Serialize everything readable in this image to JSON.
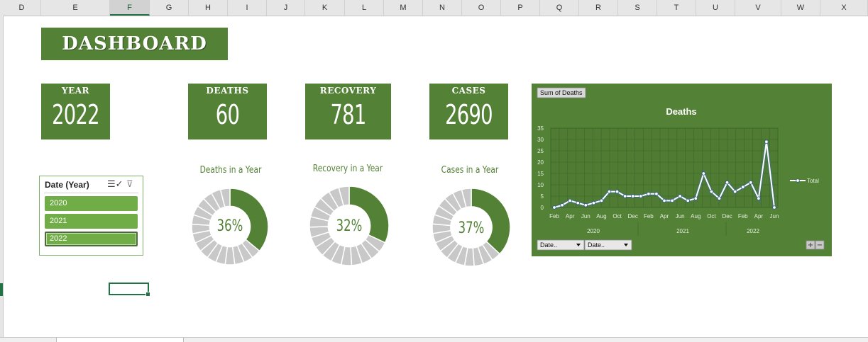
{
  "columns": [
    "D",
    "E",
    "F",
    "G",
    "H",
    "I",
    "J",
    "K",
    "L",
    "M",
    "N",
    "O",
    "P",
    "Q",
    "R",
    "S",
    "T",
    "U",
    "V",
    "W",
    "X"
  ],
  "selected_column": "F",
  "title": "DASHBOARD",
  "kpis": {
    "year": {
      "label": "YEAR",
      "value": "2022"
    },
    "deaths": {
      "label": "DEATHS",
      "value": "60"
    },
    "recovery": {
      "label": "RECOVERY",
      "value": "781"
    },
    "cases": {
      "label": "CASES",
      "value": "2690"
    }
  },
  "slicer": {
    "title": "Date (Year)",
    "items": [
      "2020",
      "2021",
      "2022"
    ],
    "selected": "2022",
    "multiselect_icon": "multi-select-icon",
    "clear_icon": "clear-filter-icon"
  },
  "donuts": [
    {
      "title": "Deaths in a Year",
      "percent_label": "36%",
      "fraction": 0.36
    },
    {
      "title": "Recovery in a Year",
      "percent_label": "32%",
      "fraction": 0.32
    },
    {
      "title": "Cases in a Year",
      "percent_label": "37%",
      "fraction": 0.37
    }
  ],
  "colors": {
    "green": "#538135",
    "slicer_green": "#70ad47",
    "grey": "#c8c8c8",
    "excel_green": "#217346"
  },
  "chart_data": {
    "type": "line",
    "title": "Deaths",
    "field_button": "Sum of Deaths",
    "legend": "Total",
    "legend_position": "right",
    "ylim": [
      0,
      35
    ],
    "yticks": [
      0,
      5,
      10,
      15,
      20,
      25,
      30,
      35
    ],
    "x_month_labels": [
      "Feb",
      "Apr",
      "Jun",
      "Aug",
      "Oct",
      "Dec",
      "Feb",
      "Apr",
      "Jun",
      "Aug",
      "Oct",
      "Dec",
      "Feb",
      "Apr",
      "Jun"
    ],
    "x_year_labels": [
      "2020",
      "2021",
      "2022"
    ],
    "grid": true,
    "series": [
      {
        "name": "Total",
        "values": [
          0,
          1,
          3,
          2,
          1,
          2,
          3,
          7,
          7,
          5,
          5,
          5,
          6,
          6,
          3,
          3,
          5,
          3,
          4,
          15,
          7,
          4,
          11,
          7,
          9,
          11,
          4,
          29,
          0
        ]
      }
    ],
    "filter_buttons": [
      "Date..",
      "Date.."
    ],
    "zoom_buttons": [
      "+",
      "−"
    ]
  }
}
